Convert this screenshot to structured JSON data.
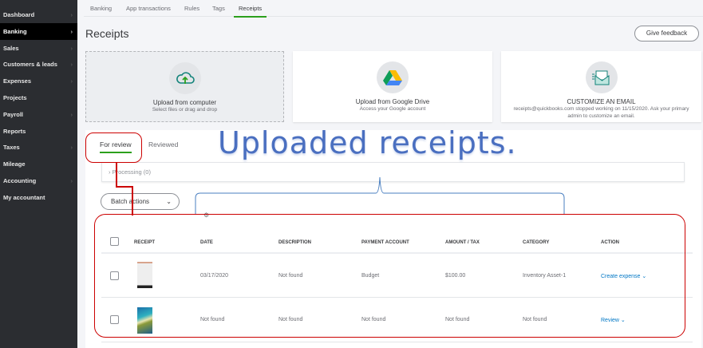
{
  "sidebar": {
    "items": [
      {
        "label": "Dashboard",
        "chevron": true
      },
      {
        "label": "Banking",
        "chevron": true,
        "active": true
      },
      {
        "label": "Sales",
        "chevron": true
      },
      {
        "label": "Customers & leads",
        "chevron": true
      },
      {
        "label": "Expenses",
        "chevron": true
      },
      {
        "label": "Projects",
        "chevron": false
      },
      {
        "label": "Payroll",
        "chevron": true
      },
      {
        "label": "Reports",
        "chevron": false
      },
      {
        "label": "Taxes",
        "chevron": true
      },
      {
        "label": "Mileage",
        "chevron": false
      },
      {
        "label": "Accounting",
        "chevron": true
      },
      {
        "label": "My accountant",
        "chevron": false
      }
    ]
  },
  "tabs": [
    "Banking",
    "App transactions",
    "Rules",
    "Tags",
    "Receipts"
  ],
  "page_title": "Receipts",
  "feedback_label": "Give feedback",
  "cards": [
    {
      "title": "Upload from computer",
      "sub": "Select files or drag and drop",
      "icon": "cloud-upload-icon"
    },
    {
      "title": "Upload from Google Drive",
      "sub": "Access your Google account",
      "icon": "google-drive-icon"
    },
    {
      "title": "CUSTOMIZE AN EMAIL",
      "sub": "receipts@quickbooks.com stopped working on 11/15/2020. Ask your primary admin to customize an email.",
      "icon": "email-icon"
    }
  ],
  "review_tabs": [
    "For review",
    "Reviewed"
  ],
  "processing": "Processing (0)",
  "batch_label": "Batch actions",
  "table": {
    "headers": [
      "RECEIPT",
      "DATE",
      "DESCRIPTION",
      "PAYMENT ACCOUNT",
      "AMOUNT / TAX",
      "CATEGORY",
      "ACTION"
    ],
    "rows": [
      {
        "date": "03/17/2020",
        "description": "Not found",
        "payment": "Budget",
        "amount": "$100.00",
        "category": "Inventory Asset-1",
        "action": "Create expense"
      },
      {
        "date": "Not found",
        "description": "Not found",
        "payment": "Not found",
        "amount": "Not found",
        "category": "Not found",
        "action": "Review"
      }
    ]
  },
  "annotation": "Uploaded receipts.",
  "colors": {
    "accent": "#2ca01c",
    "link": "#0077c5",
    "annotation_red": "#cc0000",
    "annotation_blue": "#4a6fc0"
  }
}
